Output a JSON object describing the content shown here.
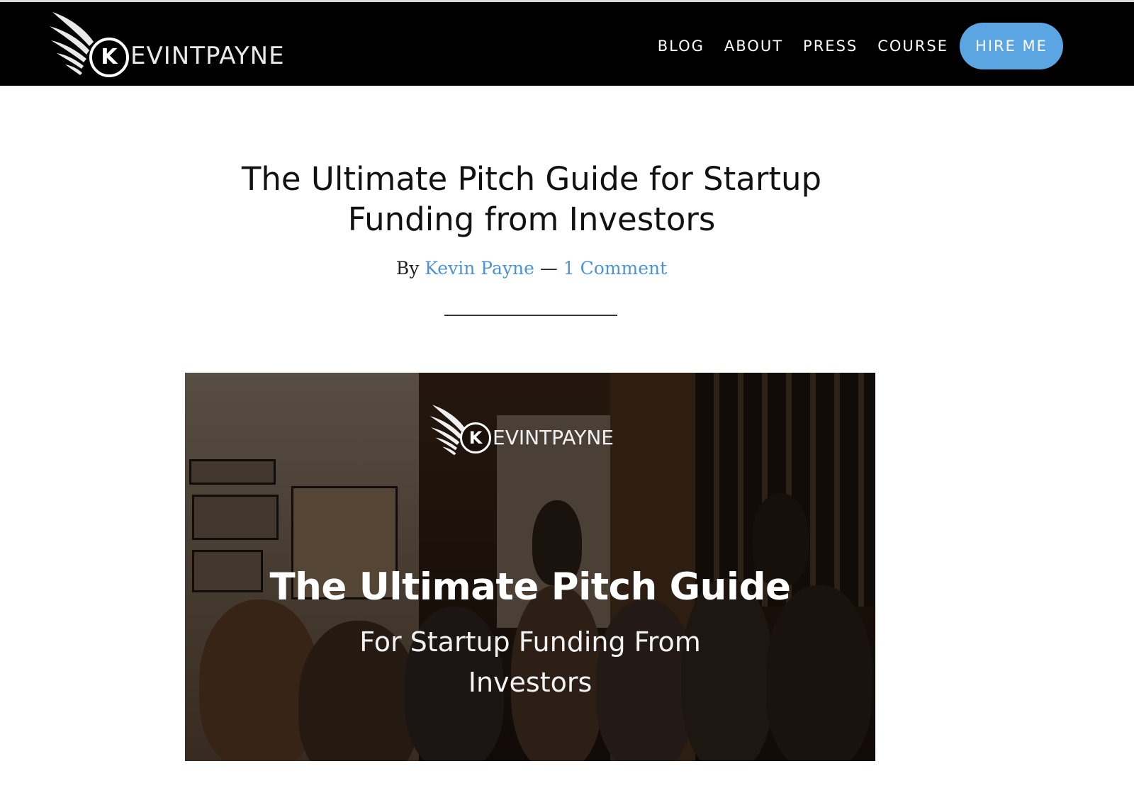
{
  "brand": {
    "initial": "K",
    "wordmark": "EVINTPAYNE"
  },
  "nav": {
    "items": [
      {
        "label": "BLOG"
      },
      {
        "label": "ABOUT"
      },
      {
        "label": "PRESS"
      },
      {
        "label": "COURSE"
      }
    ],
    "cta_label": "HIRE ME"
  },
  "article": {
    "title": "The Ultimate Pitch Guide for Startup Funding from Investors",
    "byline_prefix": "By",
    "author": "Kevin Payne",
    "separator": "—",
    "comments": "1 Comment"
  },
  "hero": {
    "logo_initial": "K",
    "logo_wordmark": "EVINTPAYNE",
    "headline": "The Ultimate Pitch Guide",
    "subheadline": "For Startup Funding From Investors"
  },
  "colors": {
    "header_bg": "#000000",
    "accent": "#5aa5e2",
    "link": "#4a94d6"
  }
}
